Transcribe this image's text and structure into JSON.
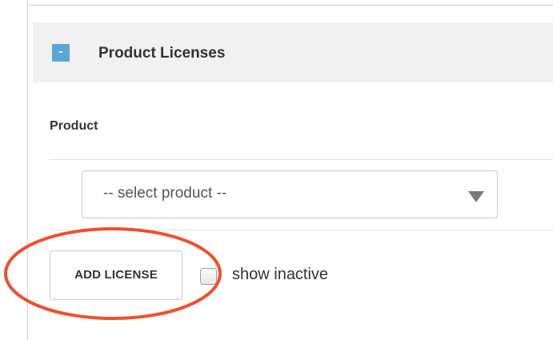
{
  "panel": {
    "collapse_symbol": "-",
    "title": "Product Licenses"
  },
  "form": {
    "product_label": "Product",
    "product_select": {
      "selected": "-- select product --"
    },
    "add_button_label": "ADD LICENSE",
    "show_inactive": {
      "label": "show inactive",
      "checked": false
    }
  },
  "colors": {
    "accent_button": "#5aa6d9",
    "annotation_circle": "#f0502a",
    "header_background": "#f1f1f1"
  },
  "icons": {
    "collapse": "minus-icon",
    "select_arrow": "chevron-down-icon"
  }
}
